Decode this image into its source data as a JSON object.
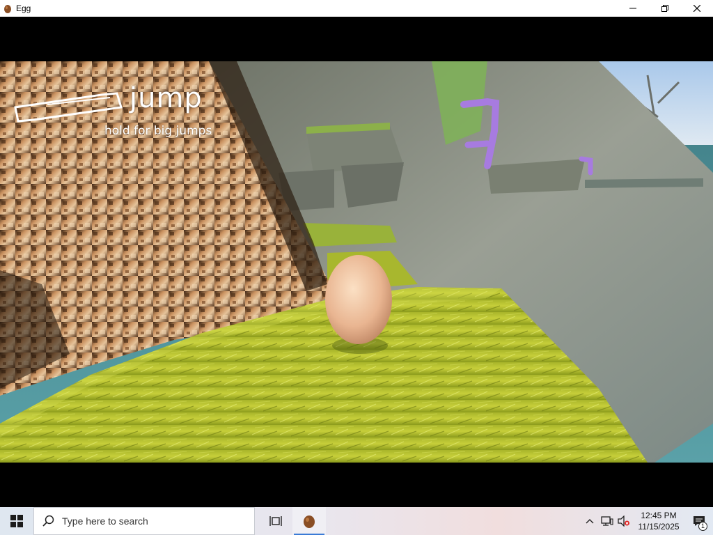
{
  "window": {
    "title": "Egg",
    "icon": "egg-icon",
    "controls": [
      "minimize-icon",
      "maximize-icon",
      "close-icon"
    ]
  },
  "hud": {
    "jump_label": "jump",
    "hint": "hold for big jumps",
    "key_icon": "spacebar-outline-icon"
  },
  "scene": {
    "player": "egg",
    "colors": {
      "grass": "#b6c42a",
      "rock": "#8e948a",
      "water": "#4b8f96",
      "sky": "#bcd3ea",
      "pipe": "#a77be0",
      "bark": "#c9915f"
    }
  },
  "taskbar": {
    "start_icon": "windows-logo-icon",
    "search_placeholder": "Type here to search",
    "task_view_icon": "task-view-icon",
    "pinned_app_icon": "egg-icon",
    "tray": {
      "chevron": "chevron-up-icon",
      "network": "network-icon",
      "volume": "volume-muted-icon",
      "time": "12:45 PM",
      "date": "11/15/2025",
      "notification_icon": "notification-icon",
      "notification_count": "1"
    }
  }
}
